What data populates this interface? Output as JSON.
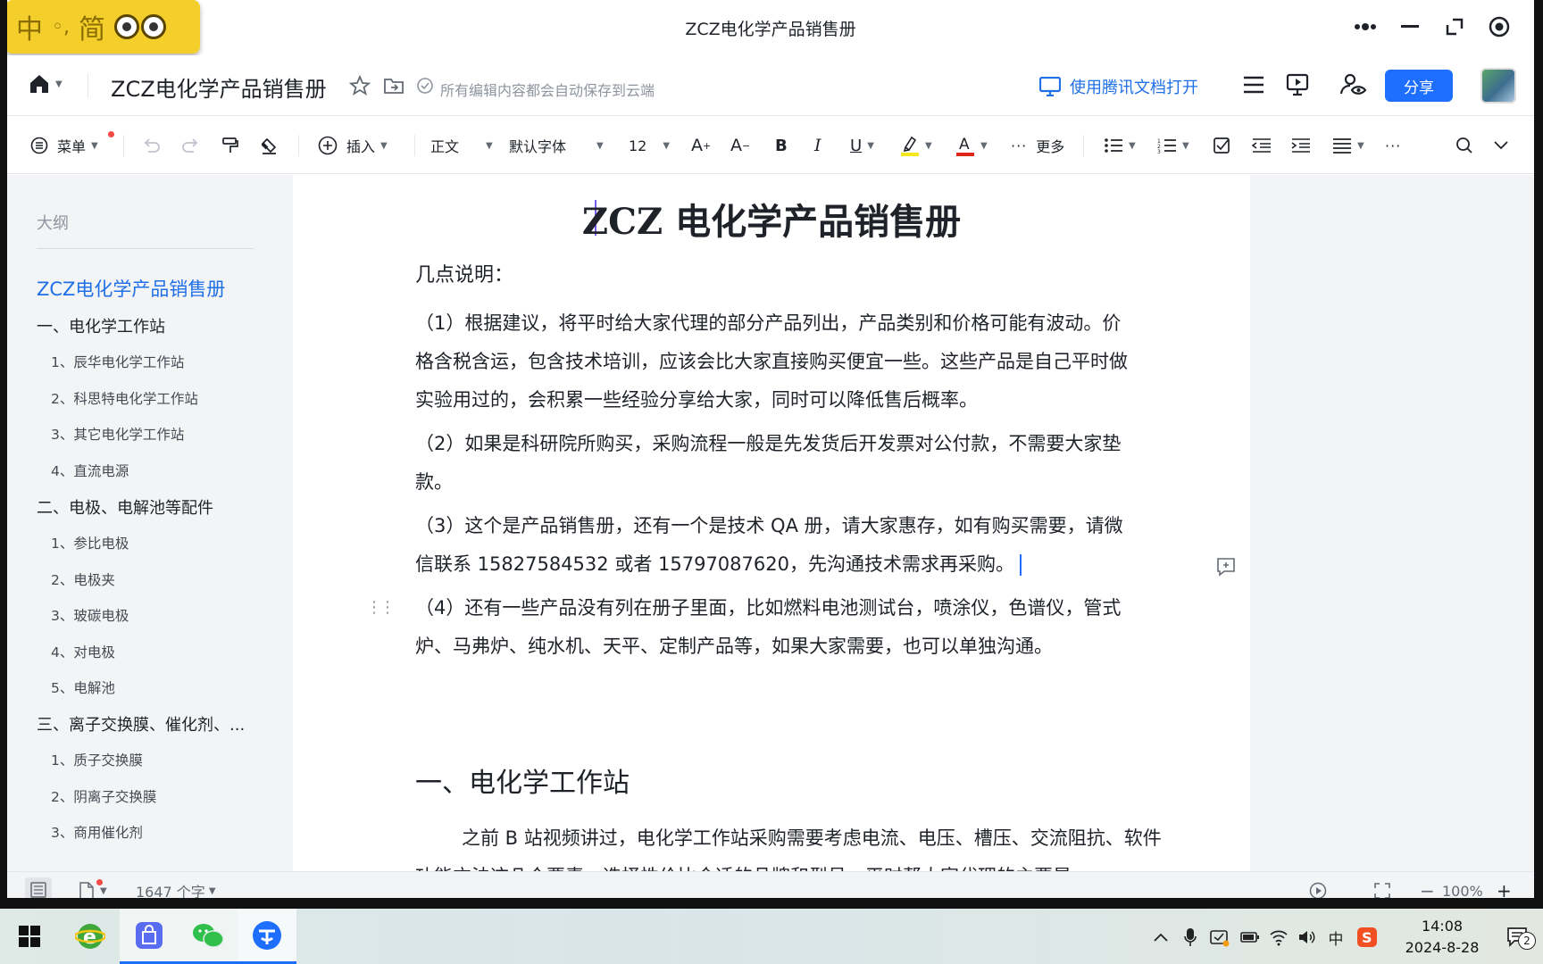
{
  "window": {
    "title": "ZCZ电化学产品销售册"
  },
  "ime": {
    "mode_zh": "中",
    "punct": "◦,",
    "script": "简"
  },
  "header": {
    "doc_title": "ZCZ电化学产品销售册",
    "save_status": "所有编辑内容都会自动保存到云端",
    "open_tencent_label": "使用腾讯文档打开",
    "share_label": "分享"
  },
  "toolbar": {
    "menu_label": "菜单",
    "insert_label": "插入",
    "style_value": "正文",
    "font_value": "默认字体",
    "size_value": "12",
    "more_label": "更多"
  },
  "outline": {
    "header": "大纲",
    "items": [
      {
        "label": "ZCZ电化学产品销售册",
        "level": 0
      },
      {
        "label": "一、电化学工作站",
        "level": 1
      },
      {
        "label": "1、辰华电化学工作站",
        "level": 2
      },
      {
        "label": "2、科思特电化学工作站",
        "level": 2
      },
      {
        "label": "3、其它电化学工作站",
        "level": 2
      },
      {
        "label": "4、直流电源",
        "level": 2
      },
      {
        "label": "二、电极、电解池等配件",
        "level": 1
      },
      {
        "label": "1、参比电极",
        "level": 2
      },
      {
        "label": "2、电极夹",
        "level": 2
      },
      {
        "label": "3、玻碳电极",
        "level": 2
      },
      {
        "label": "4、对电极",
        "level": 2
      },
      {
        "label": "5、电解池",
        "level": 2
      },
      {
        "label": "三、离子交换膜、催化剂、...",
        "level": 1
      },
      {
        "label": "1、质子交换膜",
        "level": 2
      },
      {
        "label": "2、阴离子交换膜",
        "level": 2
      },
      {
        "label": "3、商用催化剂",
        "level": 2
      }
    ]
  },
  "document": {
    "heading": "ZCZ 电化学产品销售册",
    "notes_title": "几点说明：",
    "paragraphs": [
      "（1）根据建议，将平时给大家代理的部分产品列出，产品类别和价格可能有波动。价格含税含运，包含技术培训，应该会比大家直接购买便宜一些。这些产品是自己平时做实验用过的，会积累一些经验分享给大家，同时可以降低售后概率。",
      "（2）如果是科研院所购买，采购流程一般是先发货后开发票对公付款，不需要大家垫款。",
      "（3）这个是产品销售册，还有一个是技术 QA 册，请大家惠存，如有购买需要，请微信联系 15827584532 或者 15797087620，先沟通技术需求再采购。",
      "（4）还有一些产品没有列在册子里面，比如燃料电池测试台，喷涂仪，色谱仪，管式炉、马弗炉、纯水机、天平、定制产品等，如果大家需要，也可以单独沟通。"
    ],
    "section_title": "一、电化学工作站",
    "section_text": "之前 B 站视频讲过，电化学工作站采购需要考虑电流、电压、槽压、交流阻抗、软件功能方法这几个要素，选择性价比合适的品牌和型号，平时帮大家代理的主要是"
  },
  "statusbar": {
    "word_count": "1647 个字",
    "zoom": "100%"
  },
  "taskbar": {
    "ime_indicator": "中",
    "time": "14:08",
    "date": "2024-8-28",
    "notification_count": "2"
  }
}
